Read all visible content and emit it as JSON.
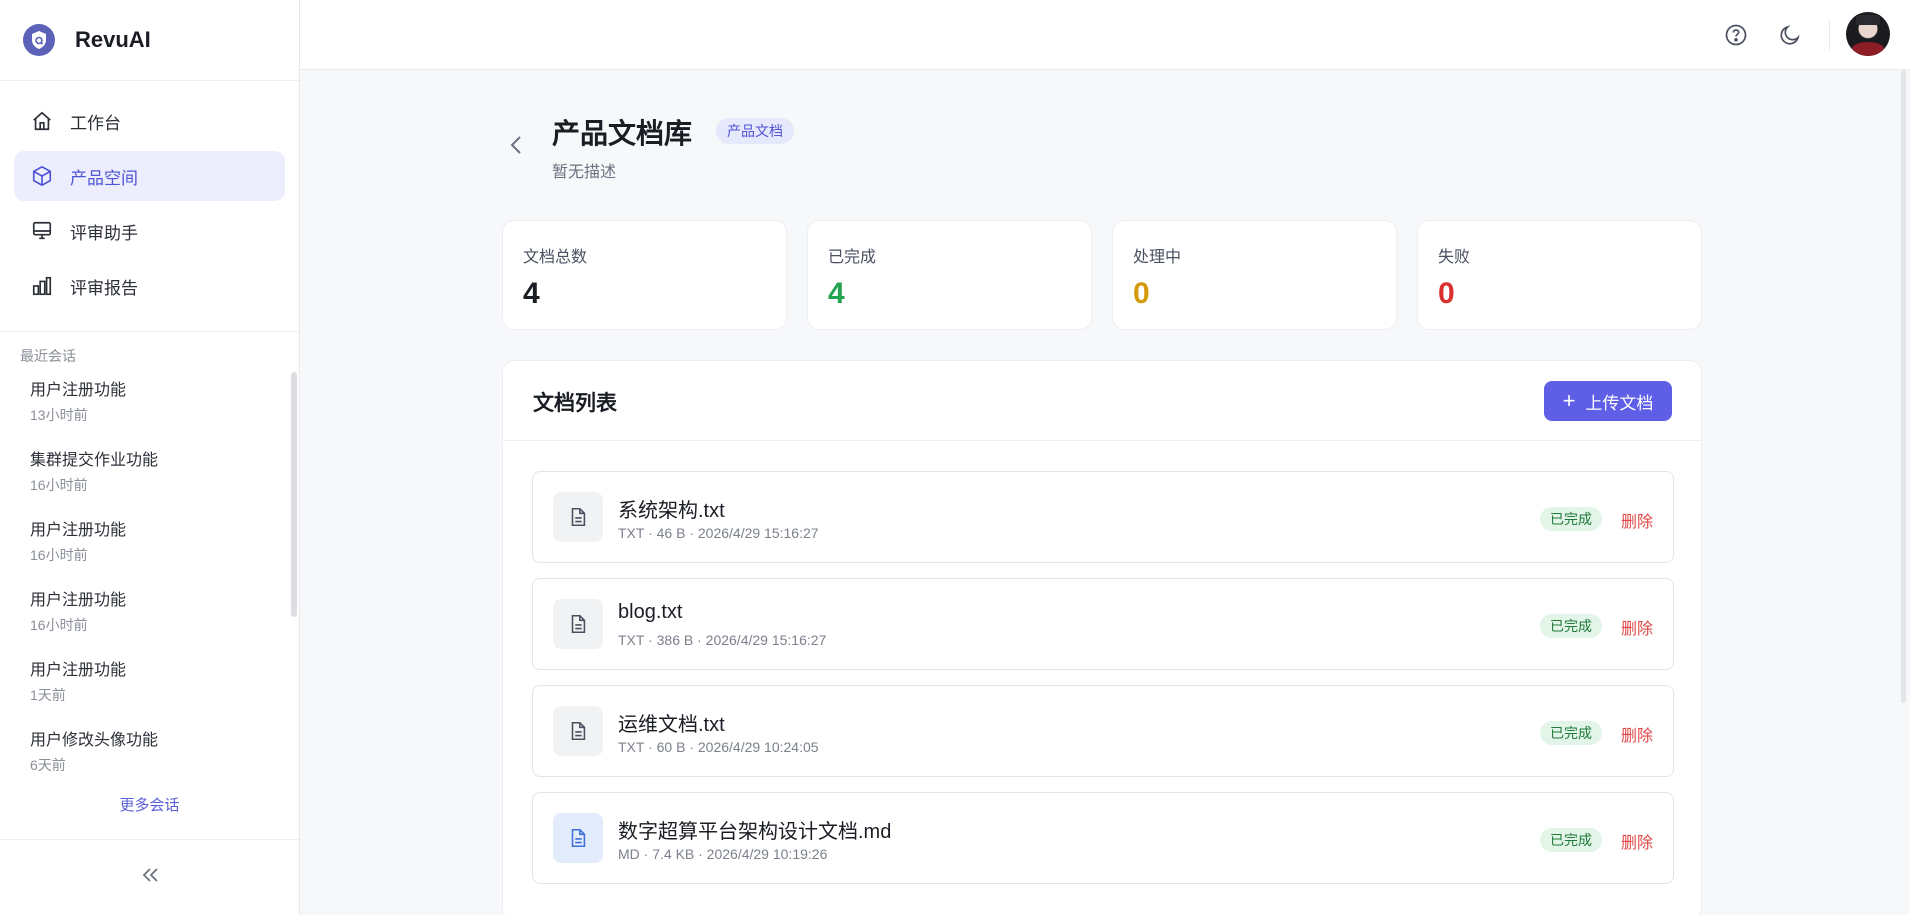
{
  "brand": {
    "name": "RevuAI"
  },
  "nav": [
    {
      "label": "工作台",
      "icon": "home-icon"
    },
    {
      "label": "产品空间",
      "icon": "cube-icon",
      "active": true
    },
    {
      "label": "评审助手",
      "icon": "monitor-icon"
    },
    {
      "label": "评审报告",
      "icon": "bar-chart-icon"
    }
  ],
  "recent": {
    "title": "最近会话",
    "items": [
      {
        "title": "用户注册功能",
        "time": "13小时前"
      },
      {
        "title": "集群提交作业功能",
        "time": "16小时前"
      },
      {
        "title": "用户注册功能",
        "time": "16小时前"
      },
      {
        "title": "用户注册功能",
        "time": "16小时前"
      },
      {
        "title": "用户注册功能",
        "time": "1天前"
      },
      {
        "title": "用户修改头像功能",
        "time": "6天前"
      }
    ],
    "more": "更多会话"
  },
  "page": {
    "title": "产品文档库",
    "tag": "产品文档",
    "desc": "暂无描述"
  },
  "stats": [
    {
      "label": "文档总数",
      "value": "4",
      "color": "#1a1d23"
    },
    {
      "label": "已完成",
      "value": "4",
      "color": "#22a350"
    },
    {
      "label": "处理中",
      "value": "0",
      "color": "#d49a0c"
    },
    {
      "label": "失败",
      "value": "0",
      "color": "#d92f2f"
    }
  ],
  "doclist": {
    "title": "文档列表",
    "upload_label": "上传文档",
    "docs": [
      {
        "name": "系统架构.txt",
        "meta": "TXT · 46 B · 2026/4/29 15:16:27",
        "status": "已完成",
        "action": "删除",
        "type": "txt"
      },
      {
        "name": "blog.txt",
        "meta": "TXT · 386 B · 2026/4/29 15:16:27",
        "status": "已完成",
        "action": "删除",
        "type": "txt"
      },
      {
        "name": "运维文档.txt",
        "meta": "TXT · 60 B · 2026/4/29 10:24:05",
        "status": "已完成",
        "action": "删除",
        "type": "txt"
      },
      {
        "name": "数字超算平台架构设计文档.md",
        "meta": "MD · 7.4 KB · 2026/4/29 10:19:26",
        "status": "已完成",
        "action": "删除",
        "type": "md"
      }
    ]
  },
  "colors": {
    "accent": "#5e5fe6",
    "active_bg": "#eceefd",
    "danger": "#e04848"
  }
}
